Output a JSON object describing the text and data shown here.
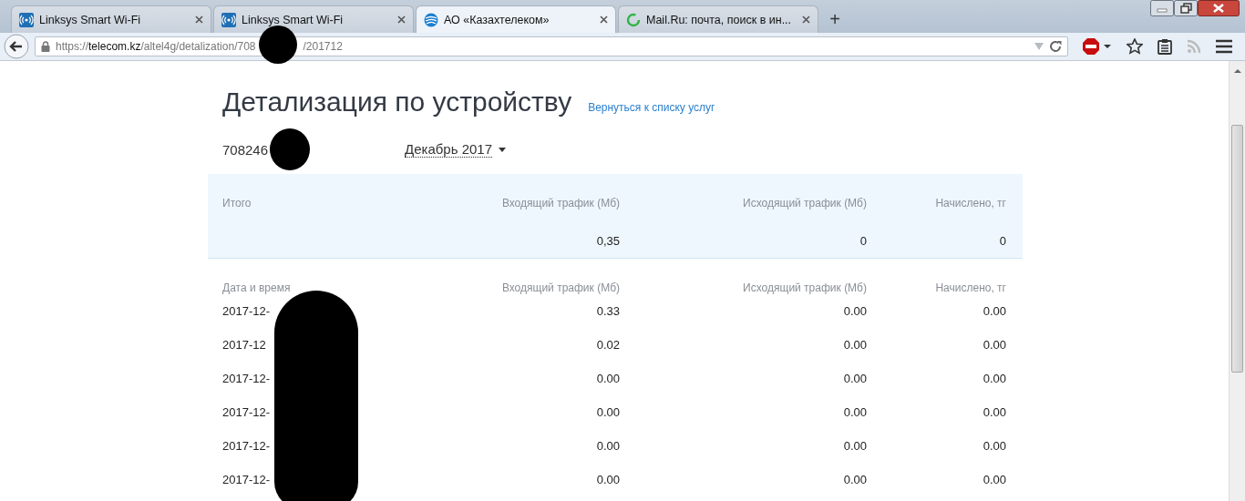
{
  "tabs": [
    {
      "title": "Linksys Smart Wi-Fi",
      "kind": "linksys",
      "selected": false
    },
    {
      "title": "Linksys Smart Wi-Fi",
      "kind": "linksys",
      "selected": false
    },
    {
      "title": "АО «Казахтелеком»",
      "kind": "globe",
      "selected": true
    },
    {
      "title": "Mail.Ru: почта, поиск в ин...",
      "kind": "loading",
      "selected": false
    }
  ],
  "new_tab": "+",
  "address_bar": {
    "scheme": "https://",
    "host": "telecom.kz",
    "path": "/altel4g/detalization/708",
    "path_after_redaction": "/201712"
  },
  "page": {
    "title": "Детализация по устройству",
    "back_link": "Вернуться к списку услуг",
    "device_number": "708246",
    "period": "Декабрь 2017",
    "summary": {
      "columns": [
        "Итого",
        "Входящий трафик (Мб)",
        "Исходящий трафик (Мб)",
        "Начислено, тг"
      ],
      "values": [
        "0,35",
        "0",
        "0"
      ]
    },
    "details": {
      "columns": [
        "Дата и время",
        "Входящий трафик (Мб)",
        "Исходящий трафик (Мб)",
        "Начислено, тг"
      ],
      "rows": [
        [
          "2017-12-",
          "0.33",
          "0.00",
          "0.00"
        ],
        [
          "2017-12",
          "0.02",
          "0.00",
          "0.00"
        ],
        [
          "2017-12-",
          "0.00",
          "0.00",
          "0.00"
        ],
        [
          "2017-12-",
          "0.00",
          "0.00",
          "0.00"
        ],
        [
          "2017-12-",
          "0.00",
          "0.00",
          "0.00"
        ],
        [
          "2017-12-",
          "0.00",
          "0.00",
          "0.00"
        ]
      ]
    }
  }
}
